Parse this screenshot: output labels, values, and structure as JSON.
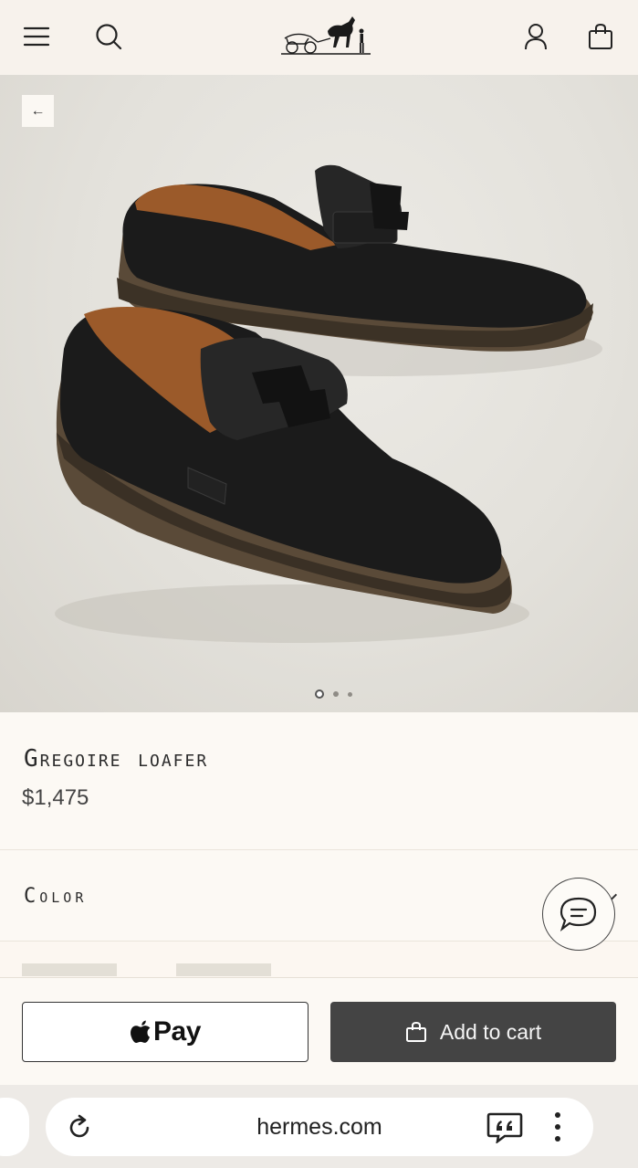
{
  "header": {
    "menu_icon": "hamburger-menu-icon",
    "search_icon": "search-icon",
    "logo_icon": "hermes-carriage-logo",
    "account_icon": "user-icon",
    "bag_icon": "shopping-bag-icon"
  },
  "gallery": {
    "back_icon": "←",
    "slides": 3,
    "active_slide": 1
  },
  "product": {
    "title": "Gregoire loafer",
    "price": "$1,475"
  },
  "color_section": {
    "label": "Color"
  },
  "actions": {
    "apple_pay_label": "Pay",
    "add_to_cart_label": "Add to cart"
  },
  "browser": {
    "url": "hermes.com"
  },
  "colors": {
    "header_bg": "#f7f2ec",
    "page_bg": "#fcf9f4",
    "cart_button": "#444444"
  }
}
